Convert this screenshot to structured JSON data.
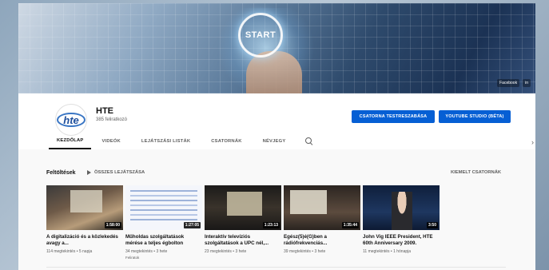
{
  "banner": {
    "start_label": "START",
    "links": [
      "Facebook",
      "in"
    ]
  },
  "channel": {
    "avatar_text": "hte",
    "name": "HTE",
    "subscribers": "385 feliratkozó"
  },
  "buttons": {
    "customize": "CSATORNA TESTRESZABÁSA",
    "studio": "YOUTUBE STUDIO (BÉTA)"
  },
  "tabs": [
    {
      "label": "KEZDŐLAP",
      "active": true
    },
    {
      "label": "VIDEÓK"
    },
    {
      "label": "LEJÁTSZÁSI LISTÁK"
    },
    {
      "label": "CSATORNÁK"
    },
    {
      "label": "NÉVJEGY"
    }
  ],
  "section": {
    "title": "Feltöltések",
    "play_all": "ÖSSZES LEJÁTSZÁSA",
    "featured_channels": "KIEMELT CSATORNÁK"
  },
  "videos": [
    {
      "title": "A digitalizáció és a közlekedés avagy a...",
      "duration": "1:58:00",
      "meta": "114 megtekintés • 5 napja",
      "badge": ""
    },
    {
      "title": "Műholdas szolgáltatások mérése a teljes égbolton",
      "duration": "1:27:05",
      "meta": "34 megtekintés • 3 hete",
      "badge": "Feliratok"
    },
    {
      "title": "Interaktív televíziós szolgáltatások a UPC nél,...",
      "duration": "1:23:13",
      "meta": "23 megtekintés • 3 hete",
      "badge": ""
    },
    {
      "title": "Egész(5)é(G)ben a rádiófrekvenciás...",
      "duration": "1:35:44",
      "meta": "39 megtekintés • 3 hete",
      "badge": ""
    },
    {
      "title": "John Vig IEEE President, HTE 60th Anniversary 2009.",
      "duration": "3:50",
      "meta": "11 megtekintés • 1 hónapja",
      "badge": ""
    }
  ]
}
